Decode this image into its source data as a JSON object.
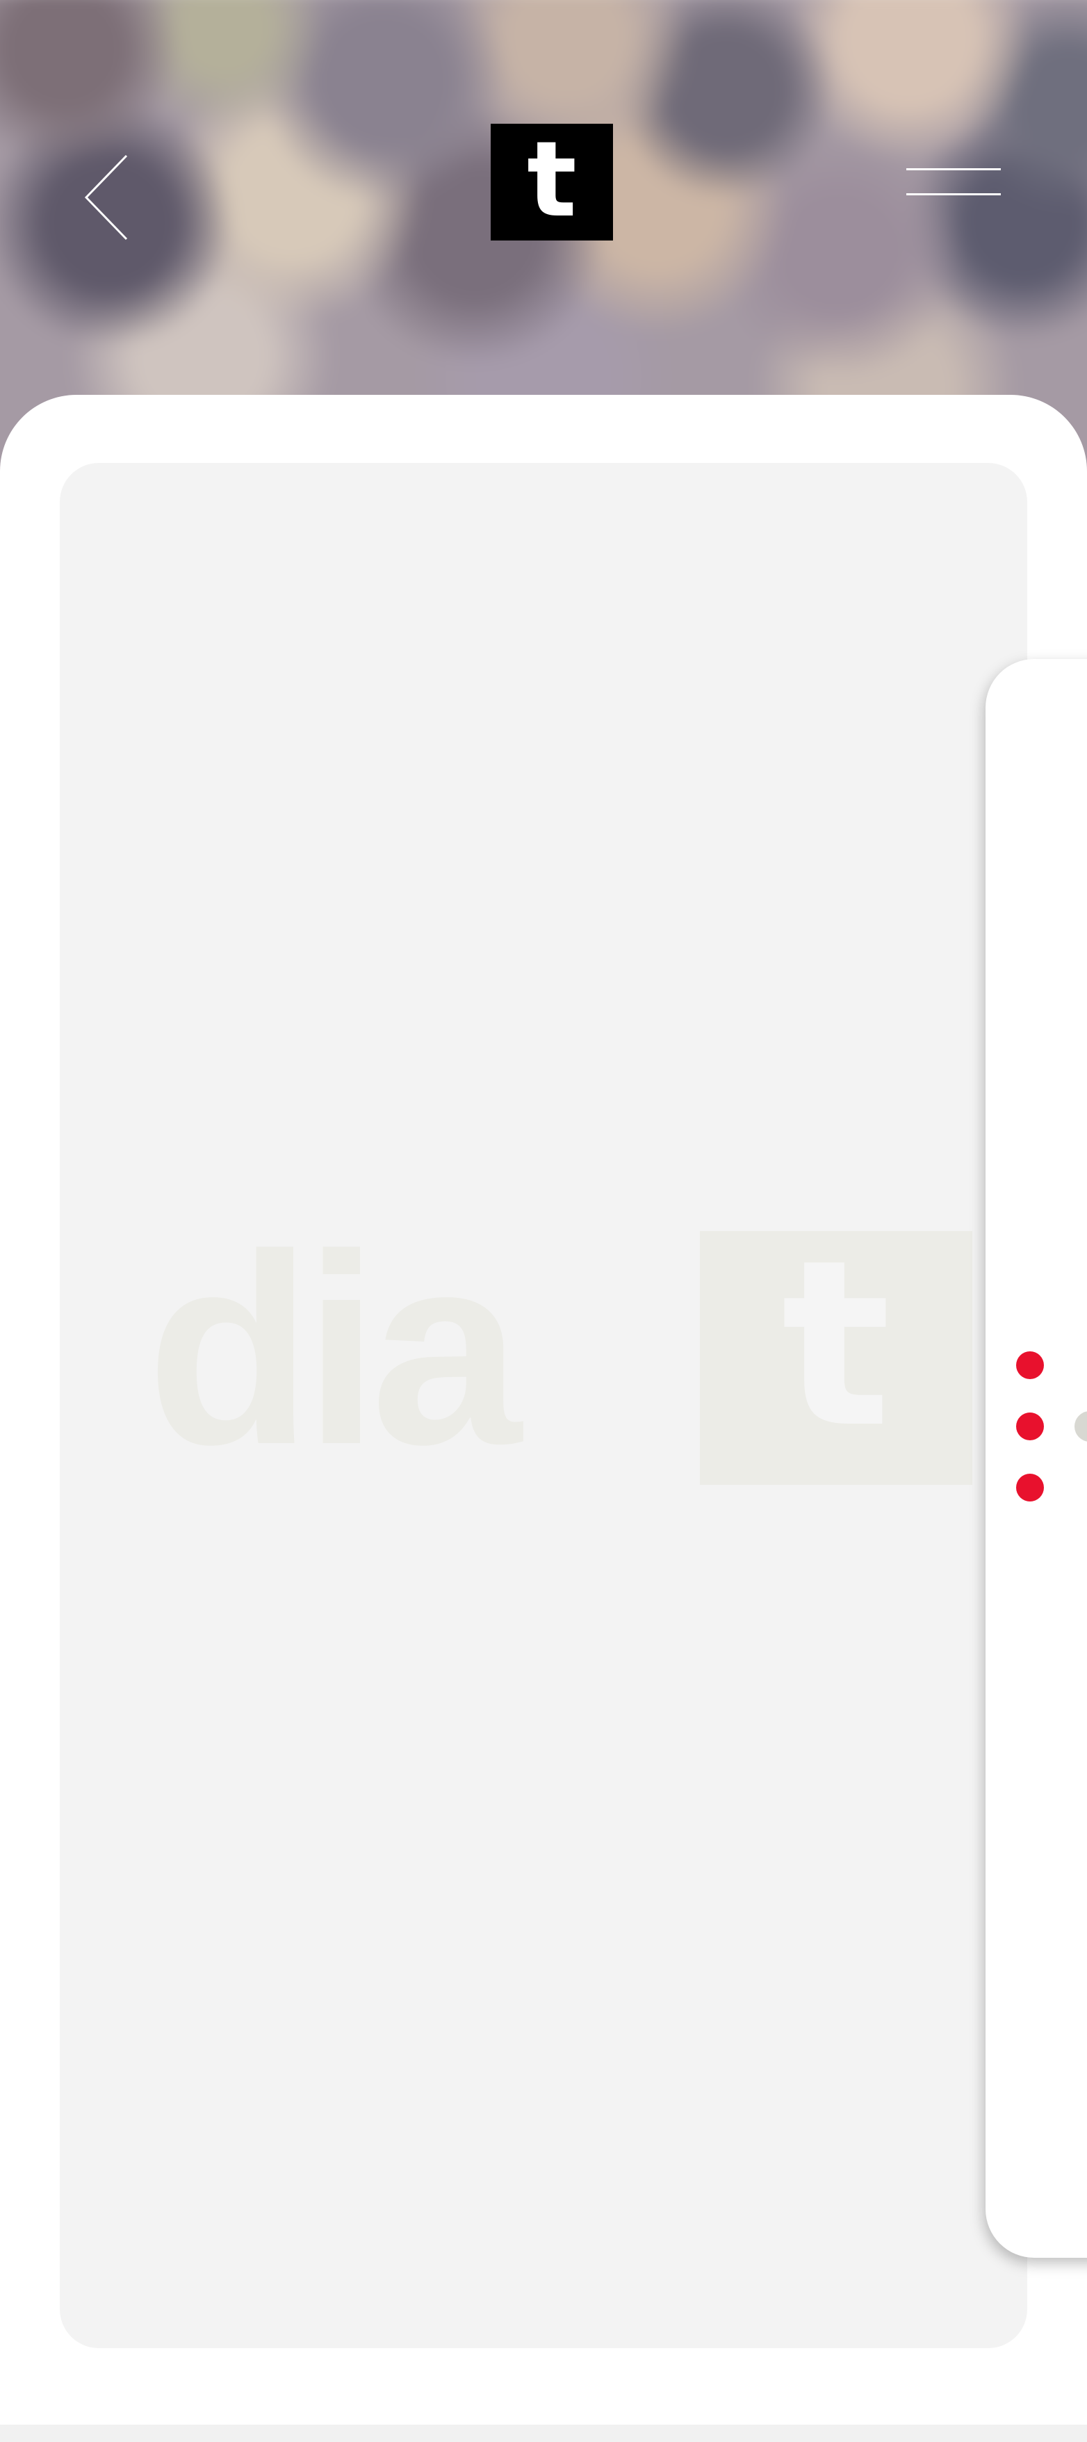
{
  "header": {
    "logo_letter": "t",
    "back_icon": "chevron-left-icon",
    "menu_icon": "menu-icon"
  },
  "content": {
    "placeholder_logo_word": "dia",
    "placeholder_logo_letter": "t"
  },
  "side_panel": {
    "more_icon": "vertical-dots-icon"
  },
  "colors": {
    "accent": "#e8112d",
    "logo_bg": "#000000",
    "placeholder_bg": "#f3f3f3",
    "placeholder_logo": "#ecece7"
  }
}
